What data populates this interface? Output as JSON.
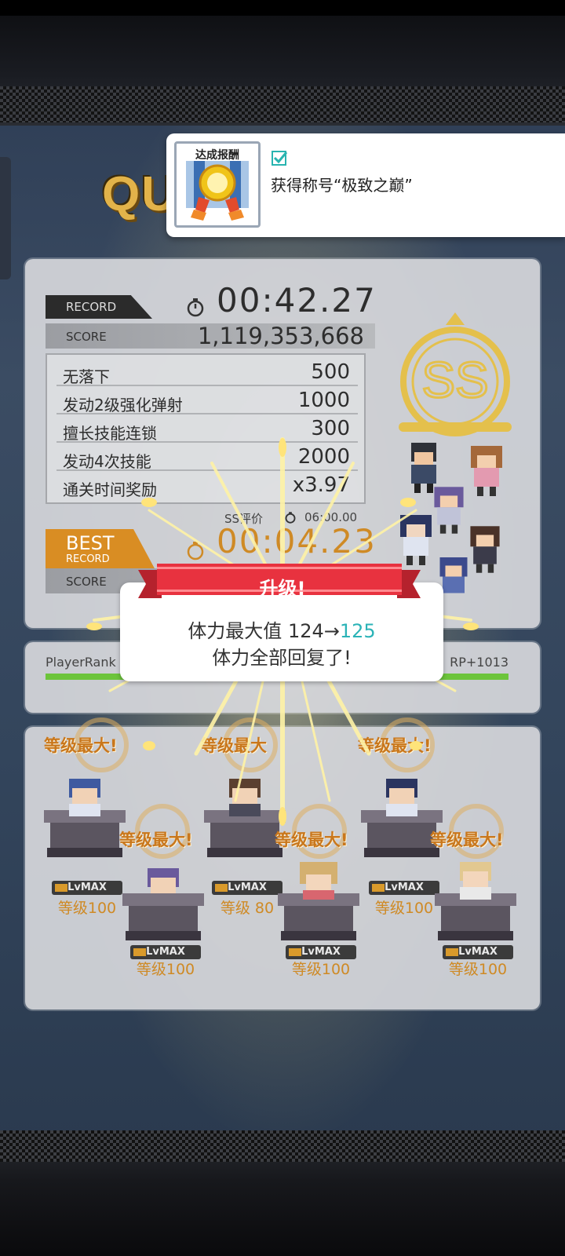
{
  "screen": {
    "quest_word": "QU",
    "colors": {
      "accent_orange": "#cf8a25",
      "highlight_teal": "#2bb3b7",
      "ribbon_red": "#e8323f",
      "rank_green": "#6cc43b"
    }
  },
  "notification": {
    "medal_title": "达成报酬",
    "check_icon": "checkbox-icon",
    "text": "获得称号“极致之巅”"
  },
  "record": {
    "record_tag": "RECORD",
    "time": "00:42.27",
    "score_label": "SCORE",
    "score_value": "1,119,353,668",
    "bonuses": [
      {
        "name": "无落下",
        "value": "500"
      },
      {
        "name": "发动2级强化弹射",
        "value": "1000"
      },
      {
        "name": "擅长技能连锁",
        "value": "300"
      },
      {
        "name": "发动4次技能",
        "value": "2000"
      },
      {
        "name": "通关时间奖励",
        "value": "x3.97"
      }
    ],
    "rank_badge": "SS",
    "ss_eval_label": "SS评价",
    "ss_eval_time": "06:00.00",
    "best_tag_big": "BEST",
    "best_tag_small": "RECORD",
    "best_time": "00:04.23",
    "best_score_label": "SCORE"
  },
  "level_up": {
    "title": "升级!",
    "line1_prefix": "体力最大值 124→",
    "line1_highlight": "125",
    "line2": "体力全部回复了!"
  },
  "player_rank": {
    "label": "PlayerRank",
    "rp": "RP+1013",
    "progress": 1.0
  },
  "party": [
    {
      "max_label": "等级最大!",
      "badge": "LvMAX",
      "level": "等级100"
    },
    {
      "max_label": "等级最大!",
      "badge": "LvMAX",
      "level": "等级100"
    },
    {
      "max_label": "等级最大",
      "badge": "LvMAX",
      "level": "等级 80"
    },
    {
      "max_label": "等级最大!",
      "badge": "LvMAX",
      "level": "等级100"
    },
    {
      "max_label": "等级最大!",
      "badge": "LvMAX",
      "level": "等级100"
    },
    {
      "max_label": "等级最大!",
      "badge": "LvMAX",
      "level": "等级100"
    }
  ]
}
